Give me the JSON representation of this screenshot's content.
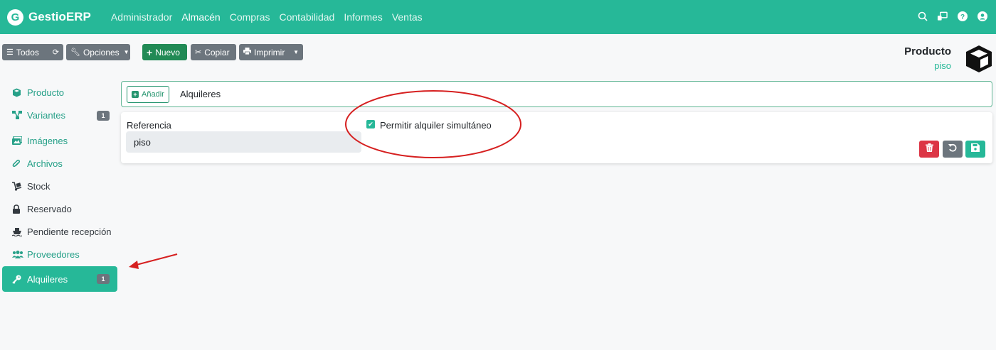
{
  "brand": {
    "logo_letter": "G",
    "name": "GestioERP"
  },
  "nav": [
    {
      "label": "Administrador",
      "active": false
    },
    {
      "label": "Almacén",
      "active": true
    },
    {
      "label": "Compras",
      "active": false
    },
    {
      "label": "Contabilidad",
      "active": false
    },
    {
      "label": "Informes",
      "active": false
    },
    {
      "label": "Ventas",
      "active": false
    }
  ],
  "top_icons": [
    "search-icon",
    "remote-icon",
    "help-icon",
    "user-icon"
  ],
  "toolbar": {
    "todos": "Todos",
    "opciones": "Opciones",
    "nuevo": "Nuevo",
    "copiar": "Copiar",
    "imprimir": "Imprimir"
  },
  "product": {
    "title": "Producto",
    "subtitle": "piso",
    "icon": "box-icon"
  },
  "sidebar": [
    {
      "label": "Producto",
      "icon": "cube-icon"
    },
    {
      "label": "Variantes",
      "icon": "sitemap-icon",
      "badge": "1"
    },
    {
      "label": "Imágenes",
      "icon": "images-icon"
    },
    {
      "label": "Archivos",
      "icon": "paperclip-icon"
    },
    {
      "label": "Stock",
      "icon": "dolly-icon"
    },
    {
      "label": "Reservado",
      "icon": "lock-icon"
    },
    {
      "label": "Pendiente recepción",
      "icon": "ship-icon"
    },
    {
      "label": "Proveedores",
      "icon": "users-icon"
    },
    {
      "label": "Alquileres",
      "icon": "key-icon",
      "badge": "1",
      "active": true
    }
  ],
  "main": {
    "add_label": "Añadir",
    "section_title": "Alquileres",
    "reference_label": "Referencia",
    "reference_value": "piso",
    "checkbox_label": "Permitir alquiler simultáneo",
    "checkbox_checked": true
  },
  "colors": {
    "brand": "#26b898",
    "danger": "#dc3545",
    "annotation": "#d62020"
  }
}
